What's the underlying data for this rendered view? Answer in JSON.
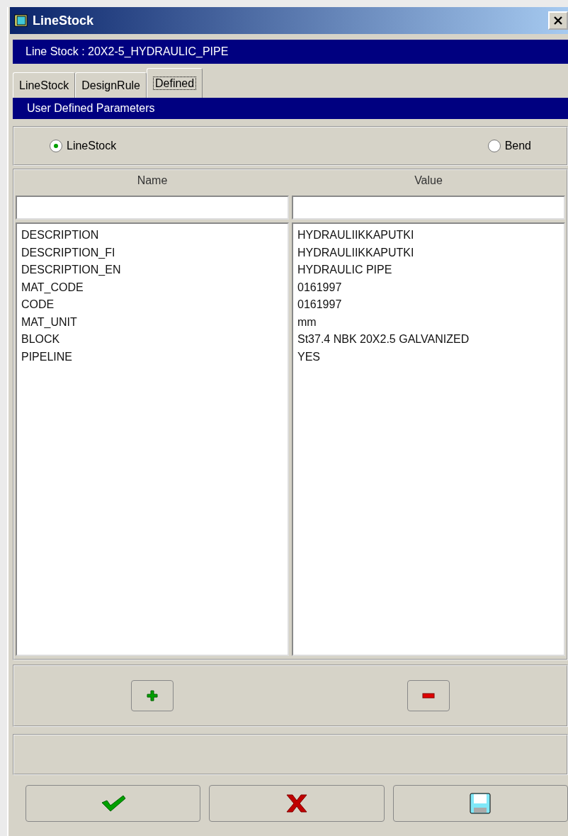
{
  "window": {
    "title": "LineStock"
  },
  "header": "Line Stock : 20X2-5_HYDRAULIC_PIPE",
  "tabs": [
    {
      "label": "LineStock",
      "selected": false
    },
    {
      "label": "DesignRule",
      "selected": false
    },
    {
      "label": "Defined",
      "selected": true
    }
  ],
  "section_title": "User Defined Parameters",
  "radios": [
    {
      "label": "LineStock",
      "selected": true
    },
    {
      "label": "Bend",
      "selected": false
    }
  ],
  "columns": [
    "Name",
    "Value"
  ],
  "rows": [
    {
      "name": "DESCRIPTION",
      "value": "HYDRAULIIKKAPUTKI"
    },
    {
      "name": "DESCRIPTION_FI",
      "value": "HYDRAULIIKKAPUTKI"
    },
    {
      "name": "DESCRIPTION_EN",
      "value": "HYDRAULIC PIPE"
    },
    {
      "name": "MAT_CODE",
      "value": "0161997"
    },
    {
      "name": "CODE",
      "value": "0161997"
    },
    {
      "name": "MAT_UNIT",
      "value": "mm"
    },
    {
      "name": "BLOCK",
      "value": "St37.4 NBK 20X2.5 GALVANIZED"
    },
    {
      "name": "PIPELINE",
      "value": "YES"
    }
  ],
  "row_buttons": [
    {
      "kind": "add"
    },
    {
      "kind": "remove"
    }
  ],
  "footer_buttons": [
    {
      "kind": "ok"
    },
    {
      "kind": "cancel"
    },
    {
      "kind": "save"
    }
  ]
}
